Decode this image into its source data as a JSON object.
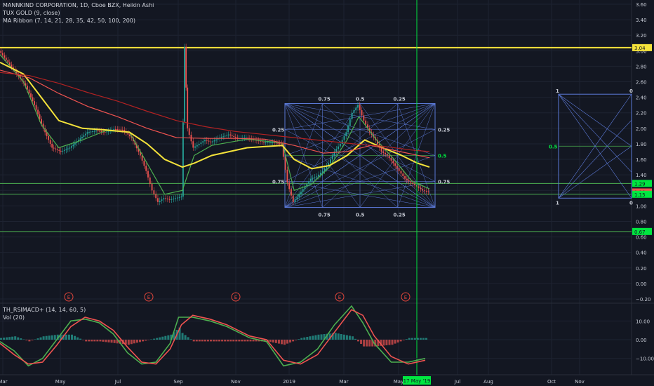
{
  "legend_main": {
    "title": "MANNKIND CORPORATION, 1D, Cboe BZX, Heikin Ashi",
    "line2": "TUX GOLD (9, close)",
    "line3": "MA Ribbon (7, 14, 21, 28, 35, 42, 50, 100, 200)"
  },
  "legend_sub": {
    "line1": "TH_RSIMACD+ (14, 14, 60, 5)",
    "line2": "Vol (20)"
  },
  "colors": {
    "background": "#131722",
    "grid": "#1e2331",
    "axis_text": "#c8ccd6",
    "up": "#26a69a",
    "down": "#ef5350",
    "yellow": "#f5e33b",
    "fib_grid": "#5b79d6",
    "green_line": "#4caf50",
    "bright_green": "#00e640",
    "earnings": "#e0463c"
  },
  "chart_data": [
    {
      "type": "line",
      "title": "",
      "series_labels": "candlestick price (Heikin Ashi) with moving-average ribbon",
      "xlabel": "",
      "ylabel": "",
      "x_tick_labels": [
        "Mar",
        "May",
        "Jul",
        "Sep",
        "Nov",
        "2019",
        "Mar",
        "May",
        "Jul",
        "Aug",
        "Oct",
        "Nov"
      ],
      "y_ticks": [
        "3.60",
        "3.40",
        "3.20",
        "3.00",
        "2.80",
        "2.60",
        "2.40",
        "2.20",
        "2.00",
        "1.80",
        "1.60",
        "1.40",
        "1.20",
        "1.00",
        "0.80",
        "0.60",
        "0.40",
        "0.20",
        "0.00",
        "−0.20"
      ],
      "ylim": [
        -0.2,
        3.6
      ],
      "grid": true,
      "horizontal_levels": [
        {
          "value": 3.04,
          "label": "3.04",
          "color": "yellow"
        },
        {
          "value": 1.29,
          "label": "1.29",
          "color": "green"
        },
        {
          "value": 1.18,
          "label": "1.18",
          "color": "red"
        },
        {
          "value": 1.15,
          "label": "1.15",
          "color": "green"
        },
        {
          "value": 0.67,
          "label": "0.67",
          "color": "green"
        }
      ],
      "price_path": [
        [
          0,
          3.0
        ],
        [
          3,
          2.85
        ],
        [
          6,
          2.7
        ],
        [
          9,
          2.55
        ],
        [
          12,
          2.3
        ],
        [
          15,
          2.0
        ],
        [
          18,
          1.75
        ],
        [
          21,
          1.7
        ],
        [
          24,
          1.75
        ],
        [
          27,
          1.85
        ],
        [
          30,
          1.95
        ],
        [
          33,
          1.97
        ],
        [
          36,
          1.95
        ],
        [
          39,
          1.99
        ],
        [
          42,
          1.98
        ],
        [
          45,
          1.88
        ],
        [
          48,
          1.65
        ],
        [
          50,
          1.45
        ],
        [
          52,
          1.2
        ],
        [
          54,
          1.05
        ],
        [
          56,
          1.1
        ],
        [
          58,
          1.08
        ],
        [
          60,
          1.1
        ],
        [
          62,
          1.12
        ],
        [
          63,
          3.05
        ],
        [
          64,
          2.0
        ],
        [
          66,
          1.75
        ],
        [
          68,
          1.8
        ],
        [
          70,
          1.85
        ],
        [
          72,
          1.82
        ],
        [
          75,
          1.88
        ],
        [
          78,
          1.92
        ],
        [
          81,
          1.87
        ],
        [
          84,
          1.88
        ],
        [
          87,
          1.85
        ],
        [
          90,
          1.82
        ],
        [
          93,
          1.82
        ],
        [
          96,
          1.8
        ],
        [
          98,
          1.3
        ],
        [
          100,
          1.05
        ],
        [
          102,
          1.15
        ],
        [
          104,
          1.25
        ],
        [
          106,
          1.35
        ],
        [
          108,
          1.38
        ],
        [
          110,
          1.45
        ],
        [
          112,
          1.55
        ],
        [
          114,
          1.7
        ],
        [
          116,
          1.8
        ],
        [
          118,
          1.95
        ],
        [
          120,
          2.2
        ],
        [
          122,
          2.3
        ],
        [
          124,
          2.1
        ],
        [
          126,
          1.95
        ],
        [
          128,
          1.85
        ],
        [
          130,
          1.7
        ],
        [
          132,
          1.65
        ],
        [
          134,
          1.55
        ],
        [
          136,
          1.45
        ],
        [
          138,
          1.35
        ],
        [
          140,
          1.3
        ],
        [
          142,
          1.25
        ],
        [
          144,
          1.2
        ],
        [
          146,
          1.18
        ]
      ],
      "ma_lines": [
        {
          "name": "MA 7 / 14 (green)",
          "color": "#4caf50",
          "points": [
            [
              0,
              2.95
            ],
            [
              8,
              2.6
            ],
            [
              14,
              2.05
            ],
            [
              20,
              1.75
            ],
            [
              28,
              1.85
            ],
            [
              36,
              1.97
            ],
            [
              44,
              1.95
            ],
            [
              50,
              1.55
            ],
            [
              56,
              1.15
            ],
            [
              62,
              1.2
            ],
            [
              66,
              1.65
            ],
            [
              72,
              1.78
            ],
            [
              84,
              1.86
            ],
            [
              96,
              1.81
            ],
            [
              100,
              1.2
            ],
            [
              106,
              1.28
            ],
            [
              112,
              1.5
            ],
            [
              118,
              1.85
            ],
            [
              122,
              2.15
            ],
            [
              128,
              1.85
            ],
            [
              134,
              1.6
            ],
            [
              140,
              1.32
            ],
            [
              146,
              1.22
            ]
          ]
        },
        {
          "name": "MA 50 (yellow)",
          "color": "#f5e33b",
          "points": [
            [
              0,
              2.85
            ],
            [
              8,
              2.7
            ],
            [
              14,
              2.4
            ],
            [
              20,
              2.1
            ],
            [
              28,
              2.0
            ],
            [
              36,
              1.98
            ],
            [
              44,
              1.95
            ],
            [
              50,
              1.8
            ],
            [
              56,
              1.6
            ],
            [
              62,
              1.5
            ],
            [
              66,
              1.55
            ],
            [
              72,
              1.65
            ],
            [
              84,
              1.75
            ],
            [
              96,
              1.78
            ],
            [
              100,
              1.6
            ],
            [
              106,
              1.48
            ],
            [
              112,
              1.52
            ],
            [
              118,
              1.65
            ],
            [
              124,
              1.85
            ],
            [
              130,
              1.75
            ],
            [
              136,
              1.66
            ],
            [
              142,
              1.55
            ],
            [
              146,
              1.5
            ]
          ]
        },
        {
          "name": "MA 100 (red)",
          "color": "#ef5350",
          "points": [
            [
              0,
              2.75
            ],
            [
              10,
              2.65
            ],
            [
              20,
              2.45
            ],
            [
              30,
              2.28
            ],
            [
              40,
              2.15
            ],
            [
              50,
              2.0
            ],
            [
              60,
              1.88
            ],
            [
              70,
              1.87
            ],
            [
              80,
              1.87
            ],
            [
              90,
              1.86
            ],
            [
              100,
              1.78
            ],
            [
              110,
              1.68
            ],
            [
              118,
              1.7
            ],
            [
              126,
              1.78
            ],
            [
              136,
              1.7
            ],
            [
              146,
              1.62
            ]
          ]
        },
        {
          "name": "MA 200 (dark red)",
          "color": "#b22222",
          "points": [
            [
              0,
              2.72
            ],
            [
              10,
              2.68
            ],
            [
              20,
              2.58
            ],
            [
              30,
              2.46
            ],
            [
              40,
              2.35
            ],
            [
              50,
              2.22
            ],
            [
              60,
              2.1
            ],
            [
              70,
              2.02
            ],
            [
              80,
              1.96
            ],
            [
              90,
              1.92
            ],
            [
              100,
              1.88
            ],
            [
              110,
              1.84
            ],
            [
              120,
              1.8
            ],
            [
              130,
              1.77
            ],
            [
              140,
              1.72
            ],
            [
              146,
              1.7
            ]
          ]
        }
      ],
      "annotations": {
        "fib_fan_left_labels_top": [
          "0.75",
          "0.5",
          "0.25"
        ],
        "fib_fan_right_labels": [
          "0.25",
          "0.5",
          "0.75"
        ],
        "fib_fan_bottom_labels": [
          "0.75",
          "0.5",
          "0.25"
        ],
        "fib_fan_left_side": [
          "0.25",
          "0.75"
        ],
        "right_box_top": [
          "1",
          "0"
        ],
        "right_box_mid": "0.5",
        "right_box_bottom": [
          "1",
          "0"
        ],
        "earnings_marker": "E",
        "cursor_date": "17 May '19"
      }
    },
    {
      "type": "line",
      "title": "",
      "xlabel": "",
      "ylabel": "",
      "y_ticks": [
        "10.00",
        "0.00",
        "−10.00"
      ],
      "ylim": [
        -15,
        15
      ],
      "series": [
        {
          "name": "",
          "color": "#4caf50",
          "points": [
            [
              0,
              -1
            ],
            [
              5,
              -6
            ],
            [
              10,
              -14
            ],
            [
              15,
              -10
            ],
            [
              20,
              0
            ],
            [
              25,
              10
            ],
            [
              30,
              11
            ],
            [
              35,
              9
            ],
            [
              40,
              3
            ],
            [
              45,
              -7
            ],
            [
              50,
              -13
            ],
            [
              55,
              -12
            ],
            [
              60,
              -2
            ],
            [
              63,
              12
            ],
            [
              68,
              12
            ],
            [
              74,
              10
            ],
            [
              80,
              7
            ],
            [
              88,
              1
            ],
            [
              94,
              -1
            ],
            [
              100,
              -14
            ],
            [
              106,
              -12
            ],
            [
              112,
              -5
            ],
            [
              118,
              8
            ],
            [
              124,
              18
            ],
            [
              128,
              9
            ],
            [
              132,
              -2
            ],
            [
              138,
              -12
            ],
            [
              144,
              -12
            ],
            [
              150,
              -10
            ]
          ]
        },
        {
          "name": "",
          "color": "#ef5350",
          "points": [
            [
              0,
              -2
            ],
            [
              5,
              -8
            ],
            [
              10,
              -13
            ],
            [
              15,
              -12
            ],
            [
              20,
              -3
            ],
            [
              25,
              7
            ],
            [
              30,
              12
            ],
            [
              35,
              10
            ],
            [
              40,
              5
            ],
            [
              45,
              -4
            ],
            [
              50,
              -12
            ],
            [
              55,
              -13
            ],
            [
              60,
              -5
            ],
            [
              64,
              8
            ],
            [
              68,
              13
            ],
            [
              74,
              11
            ],
            [
              80,
              8
            ],
            [
              88,
              2
            ],
            [
              94,
              0
            ],
            [
              100,
              -11
            ],
            [
              106,
              -13
            ],
            [
              112,
              -8
            ],
            [
              118,
              4
            ],
            [
              124,
              16
            ],
            [
              128,
              13
            ],
            [
              132,
              2
            ],
            [
              138,
              -9
            ],
            [
              144,
              -13
            ],
            [
              150,
              -11
            ]
          ]
        }
      ]
    }
  ]
}
